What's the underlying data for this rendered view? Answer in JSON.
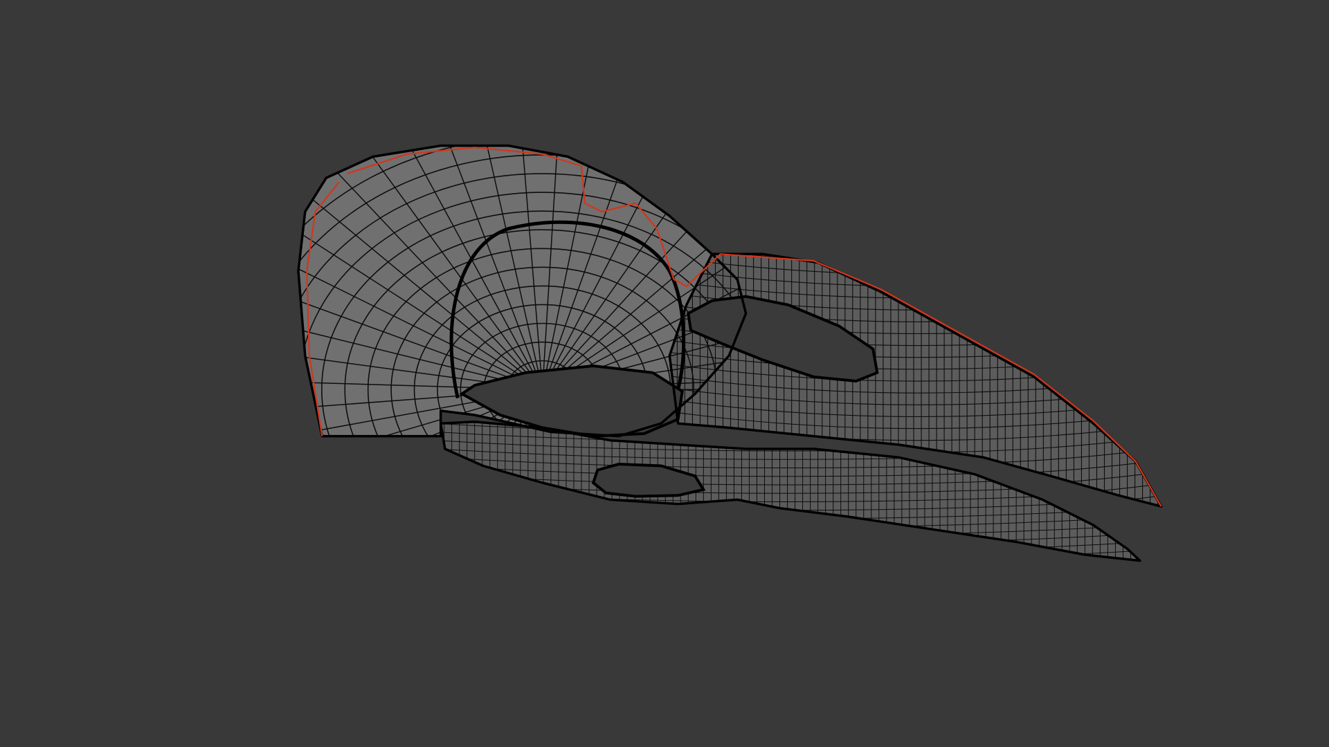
{
  "viewport": {
    "background_color": "#393939",
    "display_mode": "wireframe",
    "object": "bird-skull-mesh"
  },
  "mesh": {
    "surface_color": "#5c5c5c",
    "surface_light_color": "#707070",
    "wire_color": "#0d0d0d",
    "outline_color": "#000000",
    "seam_color": "#d2361c",
    "cavity_color": "#3a3a3a"
  }
}
